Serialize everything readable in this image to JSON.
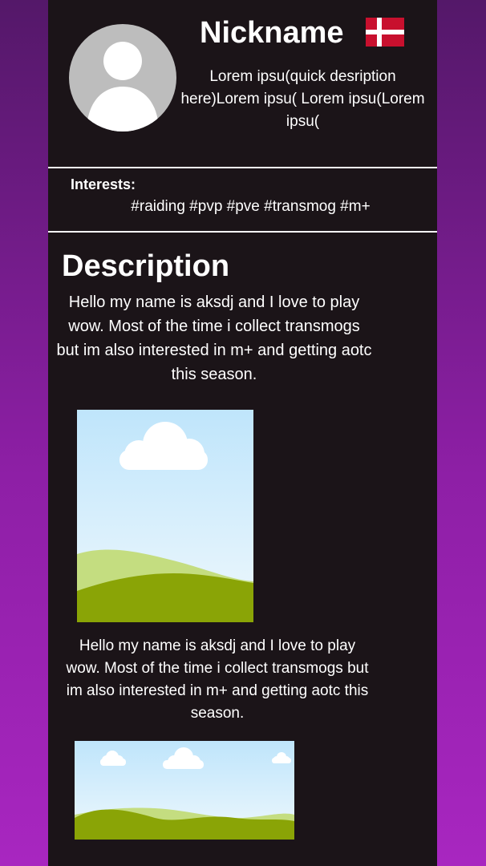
{
  "profile": {
    "nickname": "Nickname",
    "flag": "denmark-flag-icon",
    "avatar": "avatar-placeholder-icon",
    "quick_description": "Lorem ipsu(quick desription here)Lorem ipsu( Lorem ipsu(Lorem ipsu("
  },
  "interests": {
    "label": "Interests:",
    "tags": "#raiding #pvp #pve #transmog #m+"
  },
  "description": {
    "title": "Description",
    "paragraph_1": "Hello my name is  aksdj and I love to play wow. Most of the time i collect transmogs but im also interested in m+ and getting aotc this season.",
    "paragraph_2": "Hello my name is  aksdj and I love to play wow. Most of the time i collect transmogs but im also interested in m+ and getting aotc this season."
  },
  "images": {
    "first": "landscape-image-placeholder",
    "second": "landscape-image-placeholder"
  },
  "colors": {
    "background_top": "#541869",
    "background_bottom": "#a826c0",
    "panel": "#1b1418",
    "text": "#ffffff",
    "flag_red": "#c8102e",
    "sky": "#c8e9fb",
    "grass_light": "#c4dd80",
    "grass_dark": "#8aa406"
  }
}
